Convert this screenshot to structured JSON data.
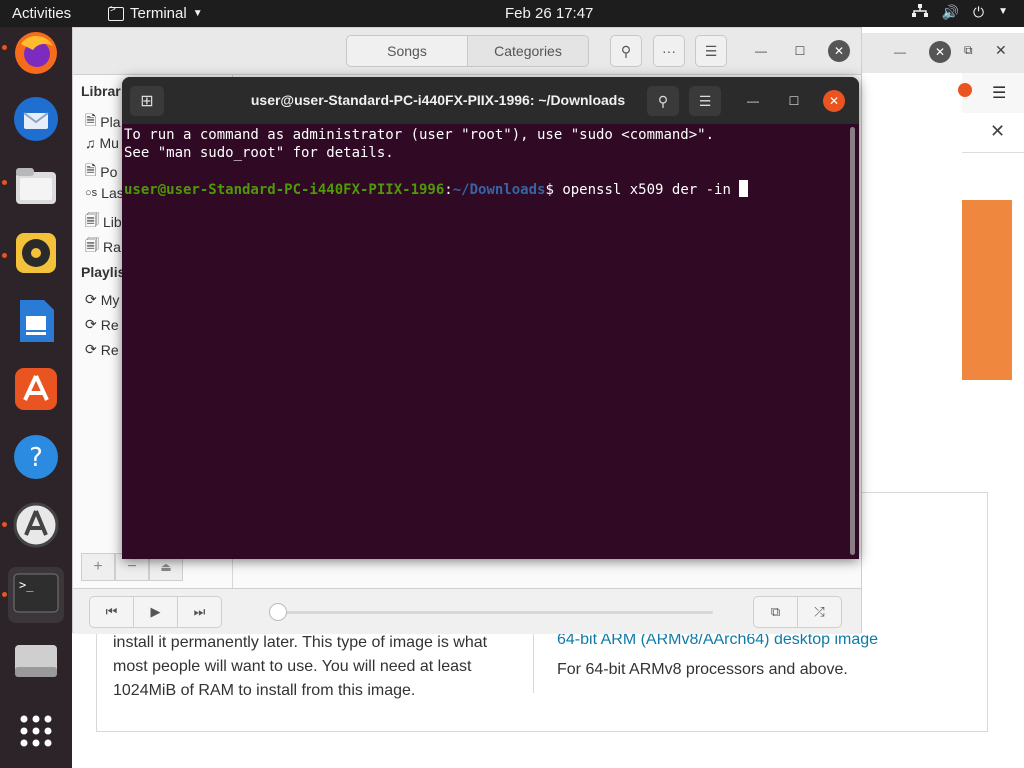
{
  "topbar": {
    "activities": "Activities",
    "app_name": "Terminal",
    "clock": "Feb 26  17:47"
  },
  "dock": {
    "items": [
      "firefox-icon",
      "thunderbird-icon",
      "files-icon",
      "rhythmbox-icon",
      "writer-icon",
      "app-center-icon",
      "help-icon",
      "software-updater-icon",
      "terminal-icon",
      "drive-icon",
      "app-grid-icon"
    ]
  },
  "music": {
    "tabs": [
      "Songs",
      "Categories"
    ],
    "sidebar": {
      "library_heading": "Librar",
      "library_items": [
        "Pla",
        "Mu",
        "Po",
        "Las",
        "Lib",
        "Ra"
      ],
      "playlists_heading": "Playlis",
      "playlist_items": [
        "My",
        "Re",
        "Re"
      ]
    }
  },
  "terminal": {
    "title": "user@user-Standard-PC-i440FX-PIIX-1996: ~/Downloads",
    "line1": "To run a command as administrator (user \"root\"), use \"sudo <command>\".",
    "line2": "See \"man sudo_root\" for details.",
    "prompt_user": "user@user-Standard-PC-i440FX-PIIX-1996",
    "prompt_sep": ":",
    "prompt_path": "~/Downloads",
    "prompt_dollar": "$ ",
    "command": "openssl x509 der -in "
  },
  "browser": {
    "left_text": "install it permanently later. This type of image is what most people will want to use. You will need at least 1024MiB of RAM to install from this image.",
    "right_link": "64-bit ARM (ARMv8/AArch64) desktop image",
    "right_text": "For 64-bit ARMv8 processors and above."
  }
}
